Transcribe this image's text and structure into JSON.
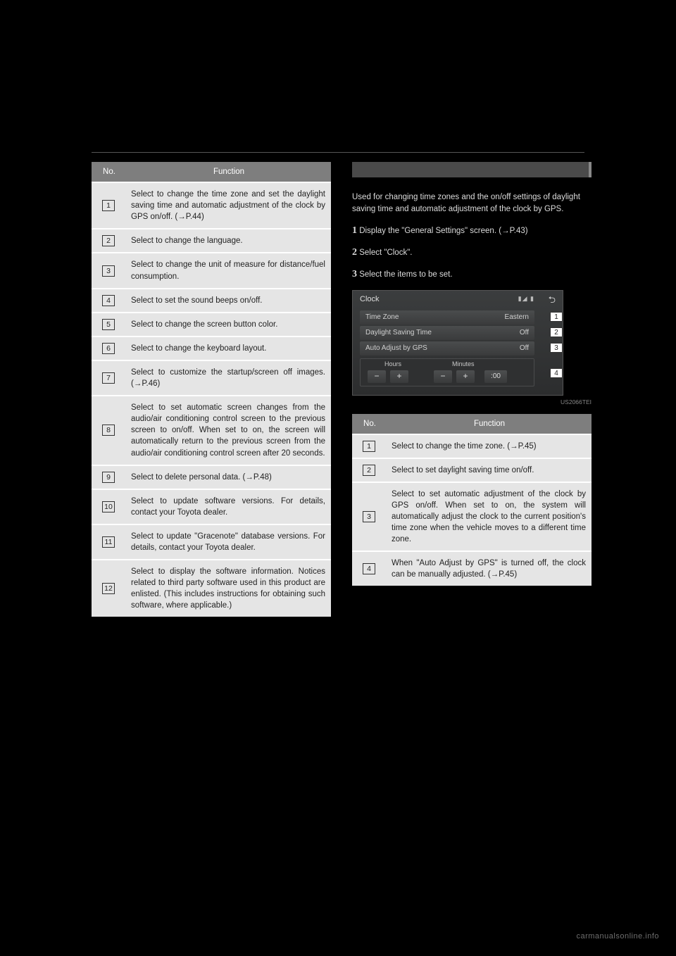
{
  "header_no": "No.",
  "header_func": "Function",
  "left_table": [
    {
      "n": "1",
      "f": "Select to change the time zone and set the daylight saving time and automatic adjustment of the clock by GPS on/off. (→P.44)"
    },
    {
      "n": "2",
      "f": "Select to change the language."
    },
    {
      "n": "3",
      "f": "Select to change the unit of measure for distance/fuel consumption."
    },
    {
      "n": "4",
      "f": "Select to set the sound beeps on/off."
    },
    {
      "n": "5",
      "f": "Select to change the screen button color."
    },
    {
      "n": "6",
      "f": "Select to change the keyboard layout."
    },
    {
      "n": "7",
      "f": "Select to customize the startup/screen off images. (→P.46)"
    },
    {
      "n": "8",
      "f": "Select to set automatic screen changes from the audio/air conditioning control screen to the previous screen to on/off. When set to on, the screen will automatically return to the previous screen from the audio/air conditioning control screen after 20 seconds."
    },
    {
      "n": "9",
      "f": "Select to delete personal data. (→P.48)"
    },
    {
      "n": "10",
      "f": "Select to update software versions. For details, contact your Toyota dealer."
    },
    {
      "n": "11",
      "f": "Select to update \"Gracenote\" database versions. For details, contact your Toyota dealer."
    },
    {
      "n": "12",
      "f": "Select to display the software information. Notices related to third party software used in this product are enlisted. (This includes instructions for obtaining such software, where applicable.)"
    }
  ],
  "right": {
    "intro": "Used for changing time zones and the on/off settings of daylight saving time and automatic adjustment of the clock by GPS.",
    "step1_num": "1",
    "step1_a": "Display the \"General Settings\" screen.",
    "step1_b": "(→P.43)",
    "step2_num": "2",
    "step2": "Select \"Clock\".",
    "step3_num": "3",
    "step3": "Select the items to be set."
  },
  "screenshot": {
    "title": "Clock",
    "back": "⮌",
    "signal": "▮◢ ▮",
    "row1_l": "Time Zone",
    "row1_r": "Eastern",
    "row2_l": "Daylight Saving Time",
    "row2_r": "Off",
    "row3_l": "Auto Adjust by GPS",
    "row3_r": "Off",
    "hours": "Hours",
    "minutes": "Minutes",
    "minus": "−",
    "plus": "+",
    "colon": ":00",
    "c1": "1",
    "c2": "2",
    "c3": "3",
    "c4": "4",
    "code": "US2066TEI"
  },
  "right_table": [
    {
      "n": "1",
      "f": "Select to change the time zone. (→P.45)"
    },
    {
      "n": "2",
      "f": "Select to set daylight saving time on/off."
    },
    {
      "n": "3",
      "f": "Select to set automatic adjustment of the clock by GPS on/off. When set to on, the system will automatically adjust the clock to the current position's time zone when the vehicle moves to a different time zone."
    },
    {
      "n": "4",
      "f": "When \"Auto Adjust by GPS\" is turned off, the clock can be manually adjusted. (→P.45)"
    }
  ],
  "footer": "carmanualsonline.info"
}
